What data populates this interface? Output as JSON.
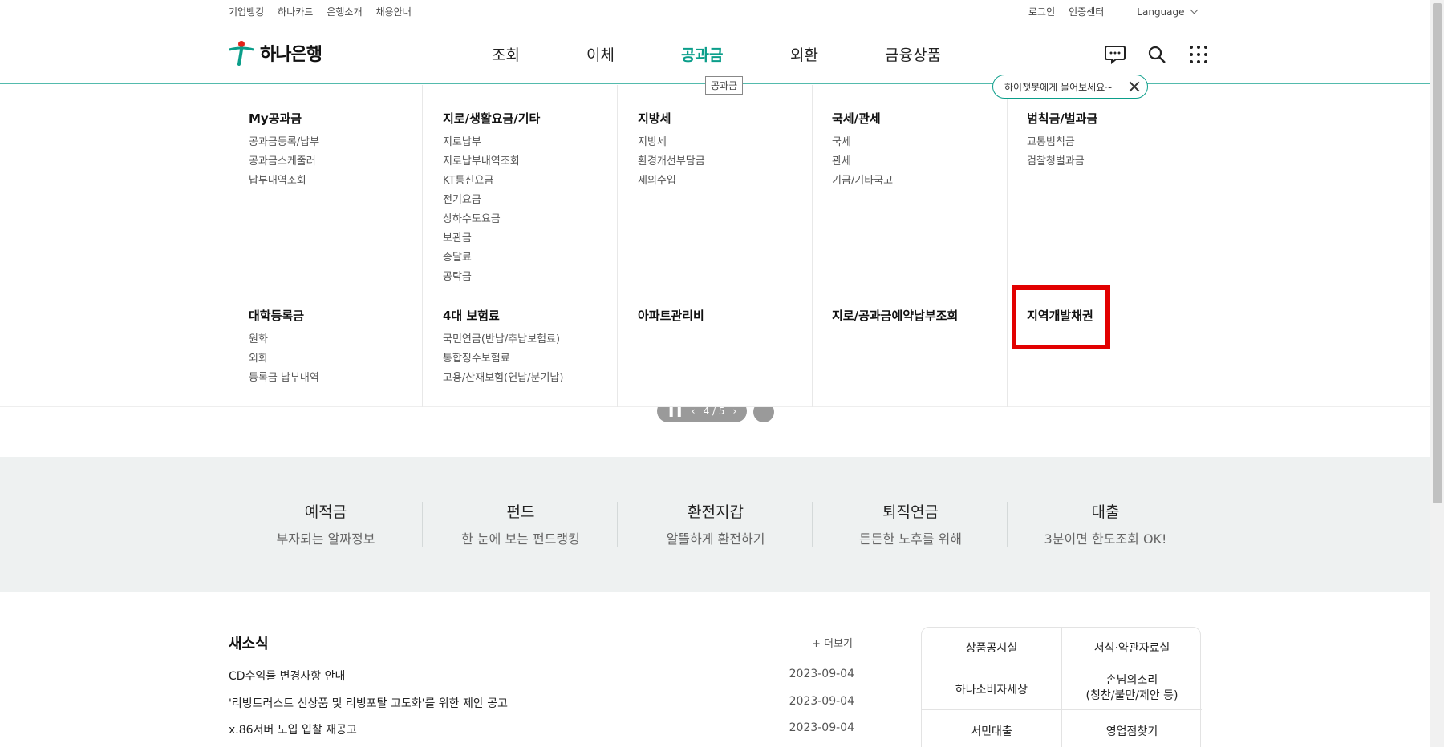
{
  "utility": {
    "left": [
      "기업뱅킹",
      "하나카드",
      "은행소개",
      "채용안내"
    ],
    "right": [
      "로그인",
      "인증센터"
    ],
    "language": "Language"
  },
  "logo": {
    "text": "하나은행"
  },
  "gnb": [
    "조회",
    "이체",
    "공과금",
    "외환",
    "금융상품"
  ],
  "gnb_tip": "공과금",
  "chatbot": {
    "text": "하이챗봇에게 물어보세요~"
  },
  "icons": [
    "chat-icon",
    "search-icon",
    "apps-grid-icon",
    "close-icon"
  ],
  "accent_color": "#0b9e8a",
  "highlight_color": "#e20000",
  "mega_menu": [
    {
      "title": "My공과금",
      "items": [
        "공과금등록/납부",
        "공과금스케줄러",
        "납부내역조회"
      ]
    },
    {
      "title": "지로/생활요금/기타",
      "items": [
        "지로납부",
        "지로납부내역조회",
        "KT통신요금",
        "전기요금",
        "상하수도요금",
        "보관금",
        "송달료",
        "공탁금"
      ]
    },
    {
      "title": "지방세",
      "items": [
        "지방세",
        "환경개선부담금",
        "세외수입"
      ]
    },
    {
      "title": "국세/관세",
      "items": [
        "국세",
        "관세",
        "기금/기타국고"
      ]
    },
    {
      "title": "범칙금/벌과금",
      "items": [
        "교통범칙금",
        "검찰청벌과금"
      ]
    },
    {
      "title": "대학등록금",
      "items": [
        "원화",
        "외화",
        "등록금 납부내역"
      ]
    },
    {
      "title": "4대 보험료",
      "items": [
        "국민연금(반납/추납보험료)",
        "통합징수보험료",
        "고용/산재보험(연납/분기납)"
      ]
    },
    {
      "title": "아파트관리비",
      "items": []
    },
    {
      "title": "지로/공과금예약납부조회",
      "items": []
    },
    {
      "title": "지역개발채권",
      "items": []
    }
  ],
  "carousel": {
    "indicator": "4 / 5"
  },
  "quick": [
    {
      "title": "예적금",
      "sub": "부자되는 알짜정보"
    },
    {
      "title": "펀드",
      "sub": "한 눈에 보는 펀드랭킹"
    },
    {
      "title": "환전지갑",
      "sub": "알뜰하게 환전하기"
    },
    {
      "title": "퇴직연금",
      "sub": "든든한 노후를 위해"
    },
    {
      "title": "대출",
      "sub": "3분이면 한도조회 OK!"
    }
  ],
  "news": {
    "title": "새소식",
    "more": "+ 더보기",
    "rows": [
      {
        "text": "CD수익률 변경사항 안내",
        "date": "2023-09-04"
      },
      {
        "text": "'리빙트러스트 신상품 및 리빙포탈 고도화'를 위한 제안 공고",
        "date": "2023-09-04"
      },
      {
        "text": "x.86서버 도입 입찰 재공고",
        "date": "2023-09-04"
      }
    ]
  },
  "quick_links": [
    "상품공시실",
    "서식·약관자료실",
    "하나소비자세상",
    "손님의소리\n(칭찬/불만/제안 등)",
    "서민대출",
    "영업점찾기"
  ]
}
